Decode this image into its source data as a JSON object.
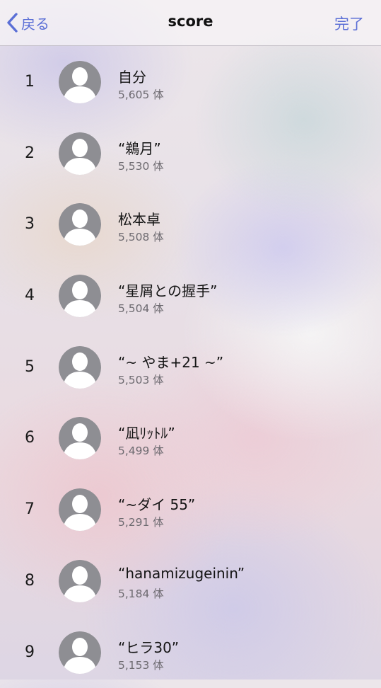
{
  "nav": {
    "back_label": "戻る",
    "title": "score",
    "done_label": "完了"
  },
  "colors": {
    "accent": "#5b6fd6",
    "avatar": "#8e8e93"
  },
  "icons": {
    "back": "chevron-left-icon",
    "avatar": "person-placeholder-icon"
  },
  "entries": [
    {
      "rank": "1",
      "name": "自分",
      "score": "5,605 体"
    },
    {
      "rank": "2",
      "name": "“鵜月”",
      "score": "5,530 体"
    },
    {
      "rank": "3",
      "name": "松本卓",
      "score": "5,508 体"
    },
    {
      "rank": "4",
      "name": "“星屑との握手”",
      "score": "5,504 体"
    },
    {
      "rank": "5",
      "name": "“~ やま+21 ~”",
      "score": "5,503 体"
    },
    {
      "rank": "6",
      "name": "“凪ﾘｯﾄﾙ”",
      "score": "5,499 体"
    },
    {
      "rank": "7",
      "name": "“~ダイ 55”",
      "score": "5,291 体"
    },
    {
      "rank": "8",
      "name": "“hanamizugeinin”",
      "score": "5,184 体"
    },
    {
      "rank": "9",
      "name": "“ヒラ30”",
      "score": "5,153 体"
    }
  ]
}
